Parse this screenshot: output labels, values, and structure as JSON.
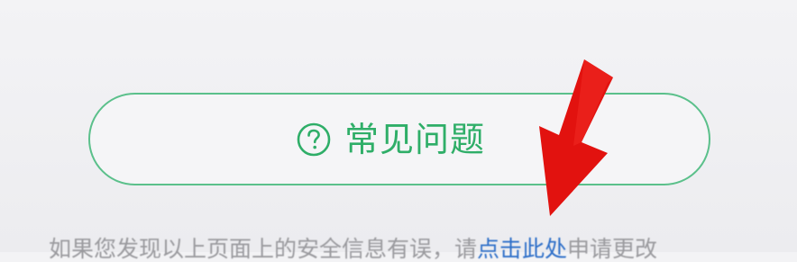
{
  "faq": {
    "label": "常见问题",
    "icon": "question-circle-icon",
    "accent_color": "#2fae68"
  },
  "notice": {
    "text_before": "如果您发现以上页面上的安全信息有误，请",
    "link_text": "点击此处",
    "text_after": "申请更改"
  },
  "overlay": {
    "arrow_color": "#e2120f"
  }
}
